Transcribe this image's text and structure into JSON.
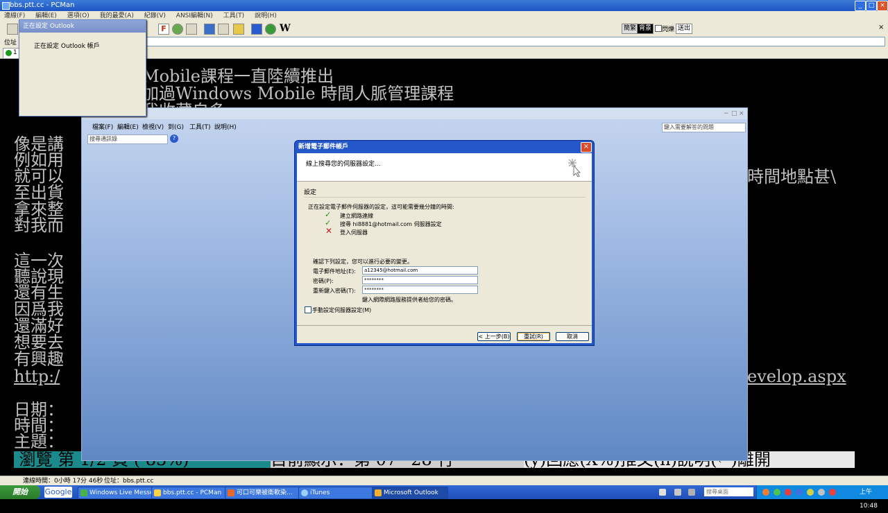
{
  "pcman": {
    "title": "bbs.ptt.cc - PCMan",
    "menu": [
      "連線(F)",
      "編輯(E)",
      "選項(O)",
      "我的最愛(A)",
      "紀錄(V)",
      "ANSI編輯(N)",
      "工具(T)",
      "說明(H)"
    ],
    "address_label": "位址",
    "toolbar_right": {
      "simplified": "簡繁",
      "background": "背景",
      "flash": "閃爍",
      "send_out": "送出"
    },
    "tab_label": "1",
    "status": {
      "connection_time": "連線時間：0小時 17分 46秒",
      "address": "位址：bbs.ptt.cc"
    }
  },
  "bbs": {
    "lines_top": [
      "Mobile課程一直陸續推出",
      "加過Windows Mobile 時間人脈管理課程",
      "我收藏自多"
    ],
    "lines_left": [
      "像是講",
      "例如用",
      "就可以",
      "至出貨",
      "拿來整",
      "對我而",
      "",
      "這一次",
      "聽說現",
      "還有生",
      "因爲我",
      "還滿好",
      "想要去",
      "有興趣",
      "http:/",
      "",
      "日期：",
      "時間：",
      "主題："
    ],
    "right_fragments": [
      "時間地點甚\\",
      "evelop.aspx"
    ],
    "footer": {
      "browse": " 瀏覽 第 1/2 頁 ( 83%)",
      "display": "目前顯示：第 07~28 行",
      "keys": "(y)回應(X%)推文(h)說明(←)離開"
    }
  },
  "config_window": {
    "title": "正在設定 Outlook",
    "message": "正在設定 Outlook 帳戶"
  },
  "outlook": {
    "menu": [
      "檔案(F)",
      "編輯(E)",
      "檢視(V)",
      "到(G)",
      "工具(T)",
      "說明(H)"
    ],
    "search_placeholder": "搜尋通訊錄",
    "help_placeholder": "鍵入需要解答的問題"
  },
  "dialog": {
    "title": "新增電子郵件帳戶",
    "header": "線上搜尋您的伺服器設定...",
    "section": "設定",
    "progress_text": "正在設定電子郵件伺服器的設定，這可能需要幾分鐘的時間:",
    "steps": [
      {
        "status": "done",
        "label": "建立網路連線"
      },
      {
        "status": "done",
        "label": "搜尋 hi8881@hotmail.com 伺服器設定"
      },
      {
        "status": "failed",
        "label": "登入伺服器"
      }
    ],
    "confirm_text": "確認下列設定，您可以進行必要的變更。",
    "fields": {
      "email_label": "電子郵件地址(E):",
      "email_value": "a12345@hotmail.com",
      "password_label": "密碼(P):",
      "password_value": "********",
      "retype_label": "重新鍵入密碼(T):",
      "retype_value": "********"
    },
    "hint": "鍵入網際網路服務提供者給您的密碼。",
    "manual_label": "手動設定伺服器設定(M)",
    "buttons": {
      "back": "< 上一步(B)",
      "retry": "重試(R)",
      "cancel": "取消"
    }
  },
  "taskbar": {
    "start": "開始",
    "google": "Google",
    "tasks": [
      "Windows Live Messe...",
      "bbs.ptt.cc - PCMan",
      "可口可樂被衛軟染...",
      "iTunes",
      "Microsoft Outlook"
    ],
    "search_placeholder": "搜尋桌面",
    "clock": "上午 10:48"
  }
}
